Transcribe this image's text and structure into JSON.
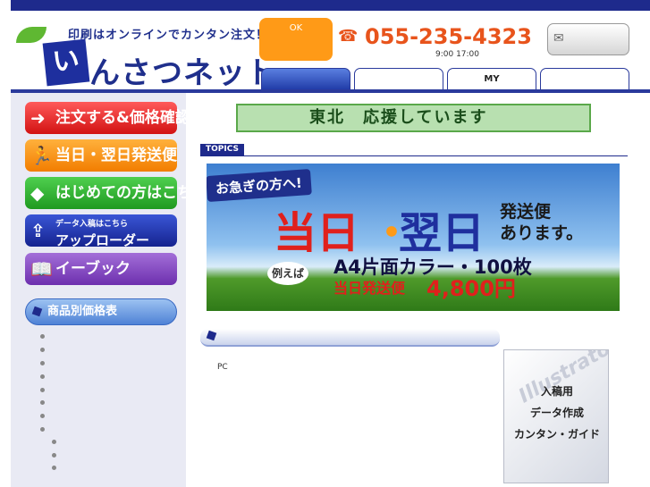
{
  "header": {
    "tagline": "印刷はオンラインでカンタン注文！",
    "logo_box": "い",
    "logo_text": "んさつネット.",
    "ok_label": "OK",
    "phone": "055-235-4323",
    "hours": "9:00 17:00",
    "tabs": [
      {
        "label": ""
      },
      {
        "label": ""
      },
      {
        "label": "MY"
      },
      {
        "label": ""
      }
    ]
  },
  "sidebar": {
    "nav": [
      {
        "label": "注文する&価格確認"
      },
      {
        "label": "当日・翌日発送便"
      },
      {
        "label": "はじめての方はこちら"
      },
      {
        "small": "データ入稿はこちら",
        "label": "アップローダー"
      },
      {
        "label": "イーブック"
      }
    ],
    "section_title": "商品別価格表"
  },
  "main": {
    "tohoku_banner": "東北　応援しています",
    "topics_label": "TOPICS",
    "hero": {
      "ribbon": "お急ぎの方へ!",
      "big1": "当日",
      "dot": "・",
      "big2": "翌日",
      "side1": "発送便",
      "side2": "あります。",
      "rei": "例えば",
      "line1": "A4片面カラー・100枚",
      "line2": "当日発送便",
      "price": "4,800円"
    },
    "pc_text": "PC",
    "guide": {
      "watermark": "Illustrator",
      "line1": "入稿用",
      "line2": "データ作成",
      "line3": "カンタン・ガイド"
    }
  }
}
